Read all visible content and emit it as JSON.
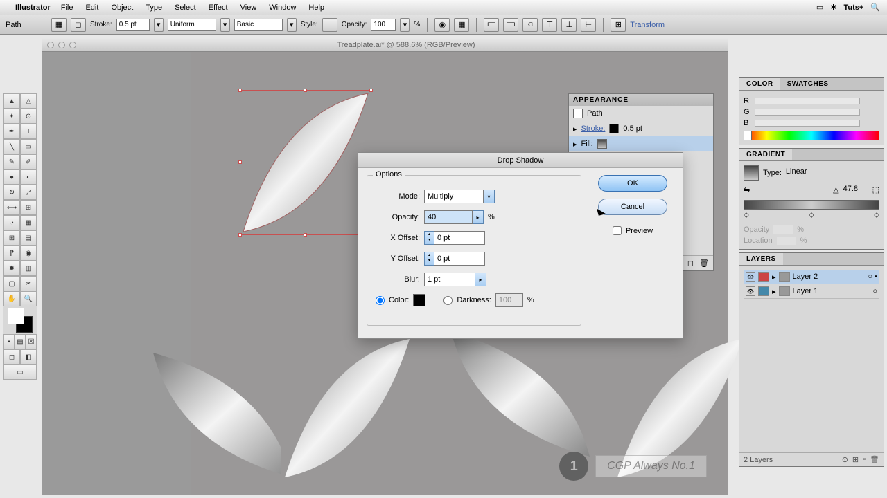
{
  "menubar": {
    "app": "Illustrator",
    "items": [
      "File",
      "Edit",
      "Object",
      "Type",
      "Select",
      "Effect",
      "View",
      "Window",
      "Help"
    ],
    "brand": "Tuts+"
  },
  "controlbar": {
    "selection": "Path",
    "stroke_label": "Stroke:",
    "stroke_value": "0.5 pt",
    "dash_style": "Uniform",
    "brush_style": "Basic",
    "style_label": "Style:",
    "opacity_label": "Opacity:",
    "opacity_value": "100",
    "opacity_unit": "%",
    "transform": "Transform"
  },
  "document": {
    "title": "Treadplate.ai* @ 588.6% (RGB/Preview)"
  },
  "appearance": {
    "title": "APPEARANCE",
    "object": "Path",
    "stroke_label": "Stroke:",
    "stroke_value": "0.5 pt",
    "fill_label": "Fill:"
  },
  "dialog": {
    "title": "Drop Shadow",
    "options_label": "Options",
    "mode_label": "Mode:",
    "mode_value": "Multiply",
    "opacity_label": "Opacity:",
    "opacity_value": "40",
    "pct": "%",
    "xoff_label": "X Offset:",
    "xoff_value": "0 pt",
    "yoff_label": "Y Offset:",
    "yoff_value": "0 pt",
    "blur_label": "Blur:",
    "blur_value": "1 pt",
    "color_label": "Color:",
    "darkness_label": "Darkness:",
    "darkness_value": "100",
    "ok": "OK",
    "cancel": "Cancel",
    "preview": "Preview"
  },
  "color_panel": {
    "tab1": "COLOR",
    "tab2": "SWATCHES",
    "r": "R",
    "g": "G",
    "b": "B"
  },
  "gradient_panel": {
    "title": "GRADIENT",
    "type_label": "Type:",
    "type_value": "Linear",
    "angle_value": "47.8",
    "opacity_label": "Opacity",
    "location_label": "Location",
    "pct": "%"
  },
  "layers_panel": {
    "title": "LAYERS",
    "layers": [
      "Layer 2",
      "Layer 1"
    ],
    "footer": "2 Layers"
  },
  "watermark": {
    "num": "1",
    "text": "CGP Always No.1"
  }
}
